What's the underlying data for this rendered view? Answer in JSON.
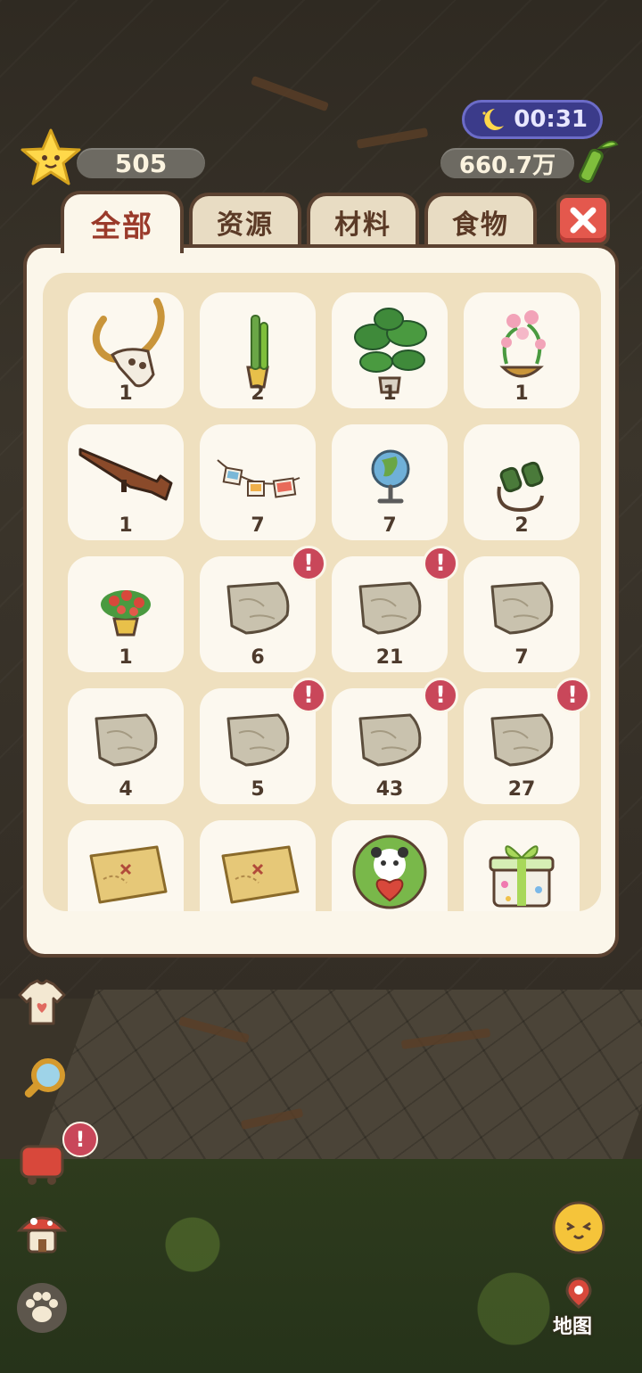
{
  "hud": {
    "stars": "505",
    "timer": "00:31",
    "coins": "660.7万"
  },
  "tabs": [
    {
      "label": "全部",
      "active": true
    },
    {
      "label": "资源",
      "active": false
    },
    {
      "label": "材料",
      "active": false
    },
    {
      "label": "食物",
      "active": false
    }
  ],
  "items": [
    {
      "name": "ram-skull-icon",
      "count": "1",
      "alert": false
    },
    {
      "name": "cactus-pot-icon",
      "count": "2",
      "alert": false
    },
    {
      "name": "monstera-plant-icon",
      "count": "1",
      "alert": false
    },
    {
      "name": "orchid-basket-icon",
      "count": "1",
      "alert": false
    },
    {
      "name": "rifle-icon",
      "count": "1",
      "alert": false
    },
    {
      "name": "photo-garland-icon",
      "count": "7",
      "alert": false
    },
    {
      "name": "globe-icon",
      "count": "7",
      "alert": false
    },
    {
      "name": "binoculars-icon",
      "count": "2",
      "alert": false
    },
    {
      "name": "flower-pot-icon",
      "count": "1",
      "alert": false
    },
    {
      "name": "map-fragment-icon",
      "count": "6",
      "alert": true
    },
    {
      "name": "map-fragment-icon",
      "count": "21",
      "alert": true
    },
    {
      "name": "map-fragment-icon",
      "count": "7",
      "alert": false
    },
    {
      "name": "map-fragment-icon",
      "count": "4",
      "alert": false
    },
    {
      "name": "map-fragment-icon",
      "count": "5",
      "alert": true
    },
    {
      "name": "map-fragment-icon",
      "count": "43",
      "alert": true
    },
    {
      "name": "map-fragment-icon",
      "count": "27",
      "alert": true
    },
    {
      "name": "treasure-map-icon",
      "count": "",
      "alert": false
    },
    {
      "name": "treasure-map-icon",
      "count": "",
      "alert": false
    },
    {
      "name": "panda-heart-badge-icon",
      "count": "",
      "alert": false
    },
    {
      "name": "gift-box-icon",
      "count": "",
      "alert": false
    }
  ],
  "alert_mark": "!",
  "map_button_label": "地图",
  "colors": {
    "accent": "#9a3a2a",
    "alert": "#c9475a",
    "close": "#e4584d",
    "panel": "#fbf6ea",
    "border": "#5b4231"
  }
}
